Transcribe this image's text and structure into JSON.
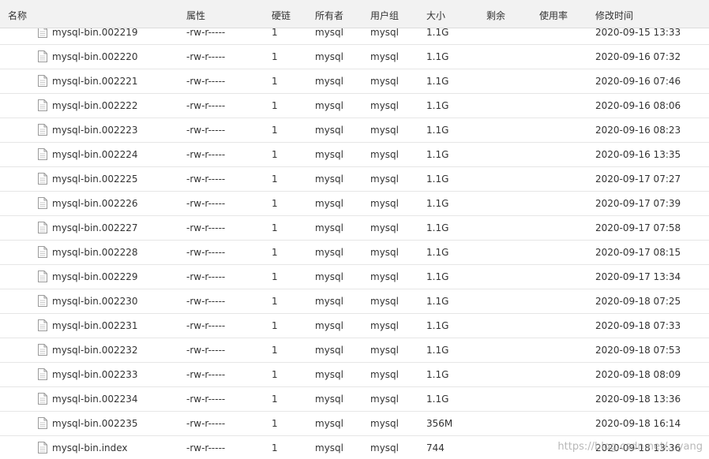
{
  "header": {
    "columns": [
      "名称",
      "属性",
      "硬链",
      "所有者",
      "用户组",
      "大小",
      "剩余",
      "使用率",
      "修改时间"
    ]
  },
  "icons": {
    "file": "file-icon"
  },
  "rows": [
    {
      "name": "mysql-bin.002219",
      "attr": "-rw-r-----",
      "links": "1",
      "owner": "mysql",
      "group": "mysql",
      "size": "1.1G",
      "remaining": "",
      "usage": "",
      "mtime": "2020-09-15 13:33"
    },
    {
      "name": "mysql-bin.002220",
      "attr": "-rw-r-----",
      "links": "1",
      "owner": "mysql",
      "group": "mysql",
      "size": "1.1G",
      "remaining": "",
      "usage": "",
      "mtime": "2020-09-16 07:32"
    },
    {
      "name": "mysql-bin.002221",
      "attr": "-rw-r-----",
      "links": "1",
      "owner": "mysql",
      "group": "mysql",
      "size": "1.1G",
      "remaining": "",
      "usage": "",
      "mtime": "2020-09-16 07:46"
    },
    {
      "name": "mysql-bin.002222",
      "attr": "-rw-r-----",
      "links": "1",
      "owner": "mysql",
      "group": "mysql",
      "size": "1.1G",
      "remaining": "",
      "usage": "",
      "mtime": "2020-09-16 08:06"
    },
    {
      "name": "mysql-bin.002223",
      "attr": "-rw-r-----",
      "links": "1",
      "owner": "mysql",
      "group": "mysql",
      "size": "1.1G",
      "remaining": "",
      "usage": "",
      "mtime": "2020-09-16 08:23"
    },
    {
      "name": "mysql-bin.002224",
      "attr": "-rw-r-----",
      "links": "1",
      "owner": "mysql",
      "group": "mysql",
      "size": "1.1G",
      "remaining": "",
      "usage": "",
      "mtime": "2020-09-16 13:35"
    },
    {
      "name": "mysql-bin.002225",
      "attr": "-rw-r-----",
      "links": "1",
      "owner": "mysql",
      "group": "mysql",
      "size": "1.1G",
      "remaining": "",
      "usage": "",
      "mtime": "2020-09-17 07:27"
    },
    {
      "name": "mysql-bin.002226",
      "attr": "-rw-r-----",
      "links": "1",
      "owner": "mysql",
      "group": "mysql",
      "size": "1.1G",
      "remaining": "",
      "usage": "",
      "mtime": "2020-09-17 07:39"
    },
    {
      "name": "mysql-bin.002227",
      "attr": "-rw-r-----",
      "links": "1",
      "owner": "mysql",
      "group": "mysql",
      "size": "1.1G",
      "remaining": "",
      "usage": "",
      "mtime": "2020-09-17 07:58"
    },
    {
      "name": "mysql-bin.002228",
      "attr": "-rw-r-----",
      "links": "1",
      "owner": "mysql",
      "group": "mysql",
      "size": "1.1G",
      "remaining": "",
      "usage": "",
      "mtime": "2020-09-17 08:15"
    },
    {
      "name": "mysql-bin.002229",
      "attr": "-rw-r-----",
      "links": "1",
      "owner": "mysql",
      "group": "mysql",
      "size": "1.1G",
      "remaining": "",
      "usage": "",
      "mtime": "2020-09-17 13:34"
    },
    {
      "name": "mysql-bin.002230",
      "attr": "-rw-r-----",
      "links": "1",
      "owner": "mysql",
      "group": "mysql",
      "size": "1.1G",
      "remaining": "",
      "usage": "",
      "mtime": "2020-09-18 07:25"
    },
    {
      "name": "mysql-bin.002231",
      "attr": "-rw-r-----",
      "links": "1",
      "owner": "mysql",
      "group": "mysql",
      "size": "1.1G",
      "remaining": "",
      "usage": "",
      "mtime": "2020-09-18 07:33"
    },
    {
      "name": "mysql-bin.002232",
      "attr": "-rw-r-----",
      "links": "1",
      "owner": "mysql",
      "group": "mysql",
      "size": "1.1G",
      "remaining": "",
      "usage": "",
      "mtime": "2020-09-18 07:53"
    },
    {
      "name": "mysql-bin.002233",
      "attr": "-rw-r-----",
      "links": "1",
      "owner": "mysql",
      "group": "mysql",
      "size": "1.1G",
      "remaining": "",
      "usage": "",
      "mtime": "2020-09-18 08:09"
    },
    {
      "name": "mysql-bin.002234",
      "attr": "-rw-r-----",
      "links": "1",
      "owner": "mysql",
      "group": "mysql",
      "size": "1.1G",
      "remaining": "",
      "usage": "",
      "mtime": "2020-09-18 13:36"
    },
    {
      "name": "mysql-bin.002235",
      "attr": "-rw-r-----",
      "links": "1",
      "owner": "mysql",
      "group": "mysql",
      "size": "356M",
      "remaining": "",
      "usage": "",
      "mtime": "2020-09-18 16:14"
    },
    {
      "name": "mysql-bin.index",
      "attr": "-rw-r-----",
      "links": "1",
      "owner": "mysql",
      "group": "mysql",
      "size": "744",
      "remaining": "",
      "usage": "",
      "mtime": "2020-09-18 13:36"
    }
  ],
  "watermark": "https://blog.csdn.net/...yang"
}
